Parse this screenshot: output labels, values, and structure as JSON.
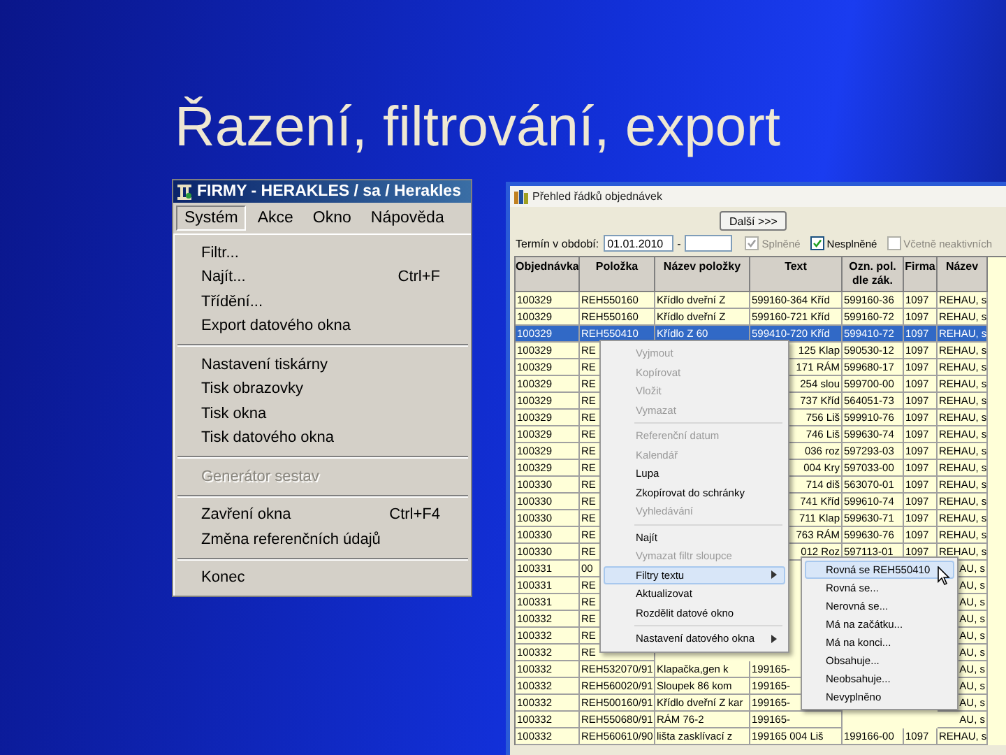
{
  "slide": {
    "title": "Řazení, filtrování, export"
  },
  "left_window": {
    "title": "FIRMY - HERAKLES / sa / Herakles",
    "menubar": [
      {
        "label": "Systém",
        "selected": true
      },
      {
        "label": "Akce",
        "selected": false
      },
      {
        "label": "Okno",
        "selected": false
      },
      {
        "label": "Nápověda",
        "selected": false
      }
    ],
    "menu": [
      {
        "kind": "item",
        "label": "Filtr...",
        "disabled": false
      },
      {
        "kind": "item",
        "label": "Najít...",
        "shortcut": "Ctrl+F",
        "disabled": false
      },
      {
        "kind": "item",
        "label": "Třídění...",
        "disabled": false
      },
      {
        "kind": "item",
        "label": "Export datového okna",
        "disabled": false
      },
      {
        "kind": "separator"
      },
      {
        "kind": "item",
        "label": "Nastavení tiskárny",
        "disabled": false
      },
      {
        "kind": "item",
        "label": "Tisk obrazovky",
        "disabled": false
      },
      {
        "kind": "item",
        "label": "Tisk okna",
        "disabled": false
      },
      {
        "kind": "item",
        "label": "Tisk datového okna",
        "disabled": false
      },
      {
        "kind": "separator"
      },
      {
        "kind": "item",
        "label": "Generátor sestav",
        "disabled": true
      },
      {
        "kind": "separator"
      },
      {
        "kind": "item",
        "label": "Zavření okna",
        "shortcut": "Ctrl+F4",
        "disabled": false
      },
      {
        "kind": "item",
        "label": "Změna referenčních údajů",
        "disabled": false
      },
      {
        "kind": "separator"
      },
      {
        "kind": "item",
        "label": "Konec",
        "disabled": false
      }
    ]
  },
  "right_window": {
    "title": "Přehled řádků objednávek",
    "next_button": "Další >>>",
    "period": {
      "label": "Termín v období:",
      "from": "01.01.2010",
      "separator": "-"
    },
    "checkboxes": [
      {
        "label": "Splněné",
        "checked": true,
        "disabled": true
      },
      {
        "label": "Nesplněné",
        "checked": true,
        "disabled": false
      },
      {
        "label": "Včetně neaktivních",
        "checked": false,
        "disabled": true
      }
    ],
    "table": {
      "columns": [
        {
          "label": "Objednávka"
        },
        {
          "label": "Položka"
        },
        {
          "label": "Název položky"
        },
        {
          "label": "Text"
        },
        {
          "label": "Ozn. pol. dle zák."
        },
        {
          "label": "Firma"
        },
        {
          "label": "Název"
        }
      ],
      "rows": [
        {
          "order": "100329",
          "item": "REH550160",
          "item_name": "Křídlo dveřní Z",
          "text": "599160-364 Kříd",
          "code": "599160-36",
          "firm": "1097",
          "firm_name": "REHAU, s",
          "selected": false
        },
        {
          "order": "100329",
          "item": "REH550160",
          "item_name": "Křídlo dveřní Z",
          "text": "599160-721 Kříd",
          "code": "599160-72",
          "firm": "1097",
          "firm_name": "REHAU, s",
          "selected": false
        },
        {
          "order": "100329",
          "item": "REH550410",
          "item_name": "Křídlo Z 60",
          "text": "599410-720 Kříd",
          "code": "599410-72",
          "firm": "1097",
          "firm_name": "REHAU, s",
          "selected": true
        },
        {
          "order": "100329",
          "item": "RE",
          "text": "125 Klap",
          "code": "590530-12",
          "firm": "1097",
          "firm_name": "REHAU, s",
          "selected": false
        },
        {
          "order": "100329",
          "item": "RE",
          "text": "171 RÁM",
          "code": "599680-17",
          "firm": "1097",
          "firm_name": "REHAU, s",
          "selected": false
        },
        {
          "order": "100329",
          "item": "RE",
          "text": "254 slou",
          "code": "599700-00",
          "firm": "1097",
          "firm_name": "REHAU, s",
          "selected": false
        },
        {
          "order": "100329",
          "item": "RE",
          "text": "737 Kříd",
          "code": "564051-73",
          "firm": "1097",
          "firm_name": "REHAU, s",
          "selected": false
        },
        {
          "order": "100329",
          "item": "RE",
          "text": "756 Liš",
          "code": "599910-76",
          "firm": "1097",
          "firm_name": "REHAU, s",
          "selected": false
        },
        {
          "order": "100329",
          "item": "RE",
          "text": "746 Liš",
          "code": "599630-74",
          "firm": "1097",
          "firm_name": "REHAU, s",
          "selected": false
        },
        {
          "order": "100329",
          "item": "RE",
          "text": "036 roz",
          "code": "597293-03",
          "firm": "1097",
          "firm_name": "REHAU, s",
          "selected": false
        },
        {
          "order": "100329",
          "item": "RE",
          "text": "004 Kry",
          "code": "597033-00",
          "firm": "1097",
          "firm_name": "REHAU, s",
          "selected": false
        },
        {
          "order": "100330",
          "item": "RE",
          "text": "714 diš",
          "code": "563070-01",
          "firm": "1097",
          "firm_name": "REHAU, s",
          "selected": false
        },
        {
          "order": "100330",
          "item": "RE",
          "text": "741 Kříd",
          "code": "599610-74",
          "firm": "1097",
          "firm_name": "REHAU, s",
          "selected": false
        },
        {
          "order": "100330",
          "item": "RE",
          "text": "711 Klap",
          "code": "599630-71",
          "firm": "1097",
          "firm_name": "REHAU, s",
          "selected": false
        },
        {
          "order": "100330",
          "item": "RE",
          "text": "763 RÁM",
          "code": "599630-76",
          "firm": "1097",
          "firm_name": "REHAU, s",
          "selected": false
        },
        {
          "order": "100330",
          "item": "RE",
          "text": "012 Roz",
          "code": "597113-01",
          "firm": "1097",
          "firm_name": "REHAU, s",
          "selected": false
        },
        {
          "order": "100331",
          "item": "00",
          "firm_name": "AU, s",
          "selected": false
        },
        {
          "order": "100331",
          "item": "RE",
          "firm_name": "AU, s",
          "selected": false
        },
        {
          "order": "100331",
          "item": "RE",
          "firm_name": "AU, s",
          "selected": false
        },
        {
          "order": "100332",
          "item": "RE",
          "firm_name": "AU, s",
          "selected": false
        },
        {
          "order": "100332",
          "item": "RE",
          "firm_name": "AU, s",
          "selected": false
        },
        {
          "order": "100332",
          "item": "RE",
          "firm_name": "AU, s",
          "selected": false
        },
        {
          "order": "100332",
          "item": "REH532070/91",
          "item_name": "Klapačka,gen k",
          "text": "199165-",
          "firm_name": "AU, s",
          "selected": false
        },
        {
          "order": "100332",
          "item": "REH560020/91",
          "item_name": "Sloupek 86 kom",
          "text": "199165-",
          "firm_name": "AU, s",
          "selected": false
        },
        {
          "order": "100332",
          "item": "REH500160/91",
          "item_name": "Křídlo dveřní Z kar",
          "text": "199165-",
          "firm_name": "AU, s",
          "selected": false
        },
        {
          "order": "100332",
          "item": "REH550680/91",
          "item_name": "RÁM 76-2",
          "text": "199165-",
          "firm_name": "AU, s",
          "selected": false
        },
        {
          "order": "100332",
          "item": "REH560610/90",
          "item_name": "lišta zasklívací z",
          "text": "199165 004 Liš",
          "code": "199166-00",
          "firm": "1097",
          "firm_name": "REHAU, s",
          "selected": false
        }
      ]
    },
    "context_menu": [
      {
        "kind": "item",
        "label": "Vyjmout",
        "disabled": true,
        "selected": false,
        "submenu": false
      },
      {
        "kind": "item",
        "label": "Kopírovat",
        "disabled": true,
        "selected": false,
        "submenu": false
      },
      {
        "kind": "item",
        "label": "Vložit",
        "disabled": true,
        "selected": false,
        "submenu": false
      },
      {
        "kind": "item",
        "label": "Vymazat",
        "disabled": true,
        "selected": false,
        "submenu": false
      },
      {
        "kind": "separator"
      },
      {
        "kind": "item",
        "label": "Referenční datum",
        "disabled": true,
        "selected": false,
        "submenu": false
      },
      {
        "kind": "item",
        "label": "Kalendář",
        "disabled": true,
        "selected": false,
        "submenu": false
      },
      {
        "kind": "item",
        "label": "Lupa",
        "disabled": false,
        "selected": false,
        "submenu": false
      },
      {
        "kind": "item",
        "label": "Zkopírovat do schránky",
        "disabled": false,
        "selected": false,
        "submenu": false
      },
      {
        "kind": "item",
        "label": "Vyhledávání",
        "disabled": true,
        "selected": false,
        "submenu": false
      },
      {
        "kind": "separator"
      },
      {
        "kind": "item",
        "label": "Najít",
        "disabled": false,
        "selected": false,
        "submenu": false
      },
      {
        "kind": "item",
        "label": "Vymazat filtr sloupce",
        "disabled": true,
        "selected": false,
        "submenu": false
      },
      {
        "kind": "item",
        "label": "Filtry textu",
        "disabled": false,
        "selected": true,
        "submenu": true
      },
      {
        "kind": "item",
        "label": "Aktualizovat",
        "disabled": false,
        "selected": false,
        "submenu": false
      },
      {
        "kind": "item",
        "label": "Rozdělit datové okno",
        "disabled": false,
        "selected": false,
        "submenu": false
      },
      {
        "kind": "separator"
      },
      {
        "kind": "item",
        "label": "Nastavení datového okna",
        "disabled": false,
        "selected": false,
        "submenu": true
      }
    ],
    "submenu": [
      {
        "label": "Rovná se REH550410",
        "selected": true
      },
      {
        "label": "Rovná se...",
        "selected": false
      },
      {
        "label": "Nerovná se...",
        "selected": false
      },
      {
        "label": "Má na začátku...",
        "selected": false
      },
      {
        "label": "Má na konci...",
        "selected": false
      },
      {
        "label": "Obsahuje...",
        "selected": false
      },
      {
        "label": "Neobsahuje...",
        "selected": false
      },
      {
        "label": "Nevyplněno",
        "selected": false
      }
    ]
  }
}
